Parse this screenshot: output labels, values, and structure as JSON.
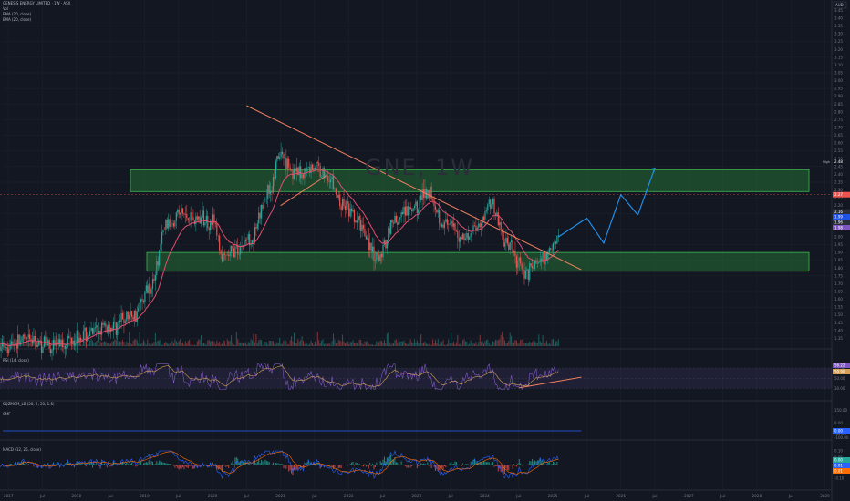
{
  "header": {
    "symbol_line": "GENESIS ENERGY LIMITED · 1W · ASX",
    "vol_label": "Vol",
    "ema1_label": "EMA (20, close)",
    "ema2_label": "EMA (20, close)",
    "corner_box": "AUD"
  },
  "watermark": "GNE, 1W",
  "colors": {
    "bg": "#131722",
    "grid": "#1e222d",
    "up": "#26a69a",
    "down": "#ef5350",
    "ema": "#e04f6f",
    "trend": "#f08060",
    "zone_fill": "rgba(46,160,67,0.35)",
    "zone_border": "#3fb950",
    "projection": "#2196f3",
    "rsi_line": "#7e57c2",
    "rsi_band": "rgba(126,87,194,0.12)",
    "rsi_ma": "#d4a15a",
    "macd": "#2962ff",
    "signal": "#ff6d00",
    "cmf": "#2962ff"
  },
  "price_axis": {
    "ticks": [
      "3.45",
      "3.40",
      "3.35",
      "3.30",
      "3.25",
      "3.20",
      "3.15",
      "3.10",
      "3.05",
      "3.00",
      "2.95",
      "2.90",
      "2.85",
      "2.80",
      "2.75",
      "2.70",
      "2.65",
      "2.60",
      "2.55",
      "2.50",
      "2.45",
      "2.40",
      "2.35",
      "2.30",
      "2.25",
      "2.20",
      "2.15",
      "2.10",
      "2.05",
      "2.00",
      "1.95",
      "1.90",
      "1.85",
      "1.80",
      "1.75",
      "1.70",
      "1.65",
      "1.60",
      "1.55",
      "1.50",
      "1.45",
      "1.40",
      "1.35"
    ],
    "high_label": "High",
    "high_value": "2.48",
    "current_value": "2.27",
    "ema_value": "2.16",
    "low_values": [
      "1.99",
      "1.96",
      "1.98"
    ]
  },
  "indicators": {
    "rsi_label": "RSI (14, close)",
    "rsi_ticks": [
      "70.00",
      "50.00",
      "30.00"
    ],
    "rsi_values": [
      "56.22",
      "50.90"
    ],
    "cmf_label": "CMF",
    "cmf_ticks": [
      "150.00",
      "0.00",
      "-40.00",
      "-100.00"
    ],
    "cmf_value": "0.00",
    "squeeze_label": "SQZMOM_LB (20, 2, 20, 1.5)",
    "macd_label": "MACD (12, 26, close)",
    "macd_ticks": [
      "0.10",
      "0.05",
      "0.00",
      "-0.05",
      "-0.10"
    ],
    "macd_values": [
      "0.00",
      "0.01",
      "0.01"
    ]
  },
  "time_axis": {
    "labels": [
      "2017",
      "Jul",
      "2018",
      "Jul",
      "2019",
      "Jul",
      "2020",
      "Jul",
      "2021",
      "Jul",
      "2022",
      "Jul",
      "2023",
      "Jul",
      "2024",
      "Jul",
      "2025",
      "Jul",
      "2026",
      "Jul",
      "2027",
      "Jul",
      "2028",
      "Jul",
      "2029"
    ]
  },
  "chart_data": {
    "type": "candlestick",
    "ylim": [
      1.3,
      3.47
    ],
    "resistance_zone": [
      2.29,
      2.43
    ],
    "support_zone": [
      1.78,
      1.9
    ],
    "trendline": [
      {
        "x": "2020-07",
        "y": 2.84
      },
      {
        "x": "2025-06",
        "y": 1.79
      }
    ],
    "uptrend": [
      {
        "x": "2021-01",
        "y": 2.2
      },
      {
        "x": "2021-09",
        "y": 2.39
      }
    ],
    "projection": [
      {
        "x": "2025-02",
        "y": 2.0
      },
      {
        "x": "2025-07",
        "y": 2.12
      },
      {
        "x": "2025-10",
        "y": 1.96
      },
      {
        "x": "2026-01",
        "y": 2.27
      },
      {
        "x": "2026-04",
        "y": 2.14
      },
      {
        "x": "2026-07",
        "y": 2.44
      }
    ],
    "price_path": [
      {
        "x": "2016-11",
        "y": 1.3
      },
      {
        "x": "2017-04",
        "y": 1.33
      },
      {
        "x": "2017-09",
        "y": 1.31
      },
      {
        "x": "2018-02",
        "y": 1.37
      },
      {
        "x": "2018-07",
        "y": 1.42
      },
      {
        "x": "2018-11",
        "y": 1.5
      },
      {
        "x": "2019-02",
        "y": 1.68
      },
      {
        "x": "2019-05",
        "y": 2.08
      },
      {
        "x": "2019-07",
        "y": 2.15
      },
      {
        "x": "2019-10",
        "y": 2.12
      },
      {
        "x": "2020-01",
        "y": 2.1
      },
      {
        "x": "2020-03",
        "y": 1.85
      },
      {
        "x": "2020-05",
        "y": 1.92
      },
      {
        "x": "2020-08",
        "y": 2.0
      },
      {
        "x": "2020-11",
        "y": 2.3
      },
      {
        "x": "2021-01",
        "y": 2.52
      },
      {
        "x": "2021-04",
        "y": 2.4
      },
      {
        "x": "2021-07",
        "y": 2.45
      },
      {
        "x": "2021-09",
        "y": 2.4
      },
      {
        "x": "2021-12",
        "y": 2.2
      },
      {
        "x": "2022-03",
        "y": 2.08
      },
      {
        "x": "2022-06",
        "y": 1.85
      },
      {
        "x": "2022-09",
        "y": 2.1
      },
      {
        "x": "2022-12",
        "y": 2.16
      },
      {
        "x": "2023-03",
        "y": 2.3
      },
      {
        "x": "2023-06",
        "y": 2.08
      },
      {
        "x": "2023-09",
        "y": 2.0
      },
      {
        "x": "2023-12",
        "y": 2.08
      },
      {
        "x": "2024-02",
        "y": 2.22
      },
      {
        "x": "2024-05",
        "y": 1.95
      },
      {
        "x": "2024-08",
        "y": 1.78
      },
      {
        "x": "2024-11",
        "y": 1.85
      },
      {
        "x": "2025-02",
        "y": 2.0
      }
    ]
  }
}
